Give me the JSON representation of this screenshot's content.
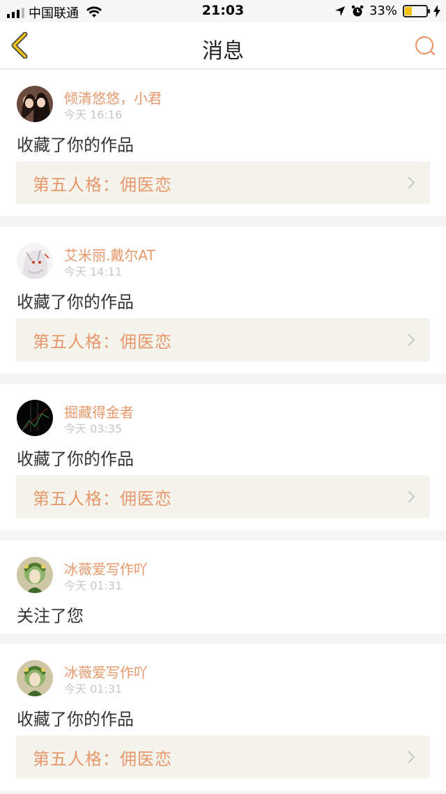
{
  "status_bar": {
    "carrier": "中国联通",
    "time": "21:03",
    "battery_percent": "33%",
    "battery_level": 0.33,
    "icons": [
      "signal-icon",
      "wifi-icon",
      "location-icon",
      "alarm-icon",
      "battery-icon",
      "charging-icon"
    ]
  },
  "header": {
    "title": "消息",
    "back_icon": "chevron-left-icon",
    "search_icon": "search-icon",
    "accent_color": "#e7976a",
    "back_color": "#d9a200"
  },
  "messages": [
    {
      "username": "倾清悠悠，小君",
      "time": "今天 16:16",
      "action": "收藏了你的作品",
      "work_title": "第五人格：佣医恋"
    },
    {
      "username": "艾米丽.戴尔AT",
      "time": "今天 14:11",
      "action": "收藏了你的作品",
      "work_title": "第五人格：佣医恋"
    },
    {
      "username": "掘藏得金者",
      "time": "今天 03:35",
      "action": "收藏了你的作品",
      "work_title": "第五人格：佣医恋"
    },
    {
      "username": "冰薇爱写作吖",
      "time": "今天 01:31",
      "action": "关注了您"
    },
    {
      "username": "冰薇爱写作吖",
      "time": "今天 01:31",
      "action": "收藏了你的作品",
      "work_title": "第五人格：佣医恋"
    }
  ]
}
